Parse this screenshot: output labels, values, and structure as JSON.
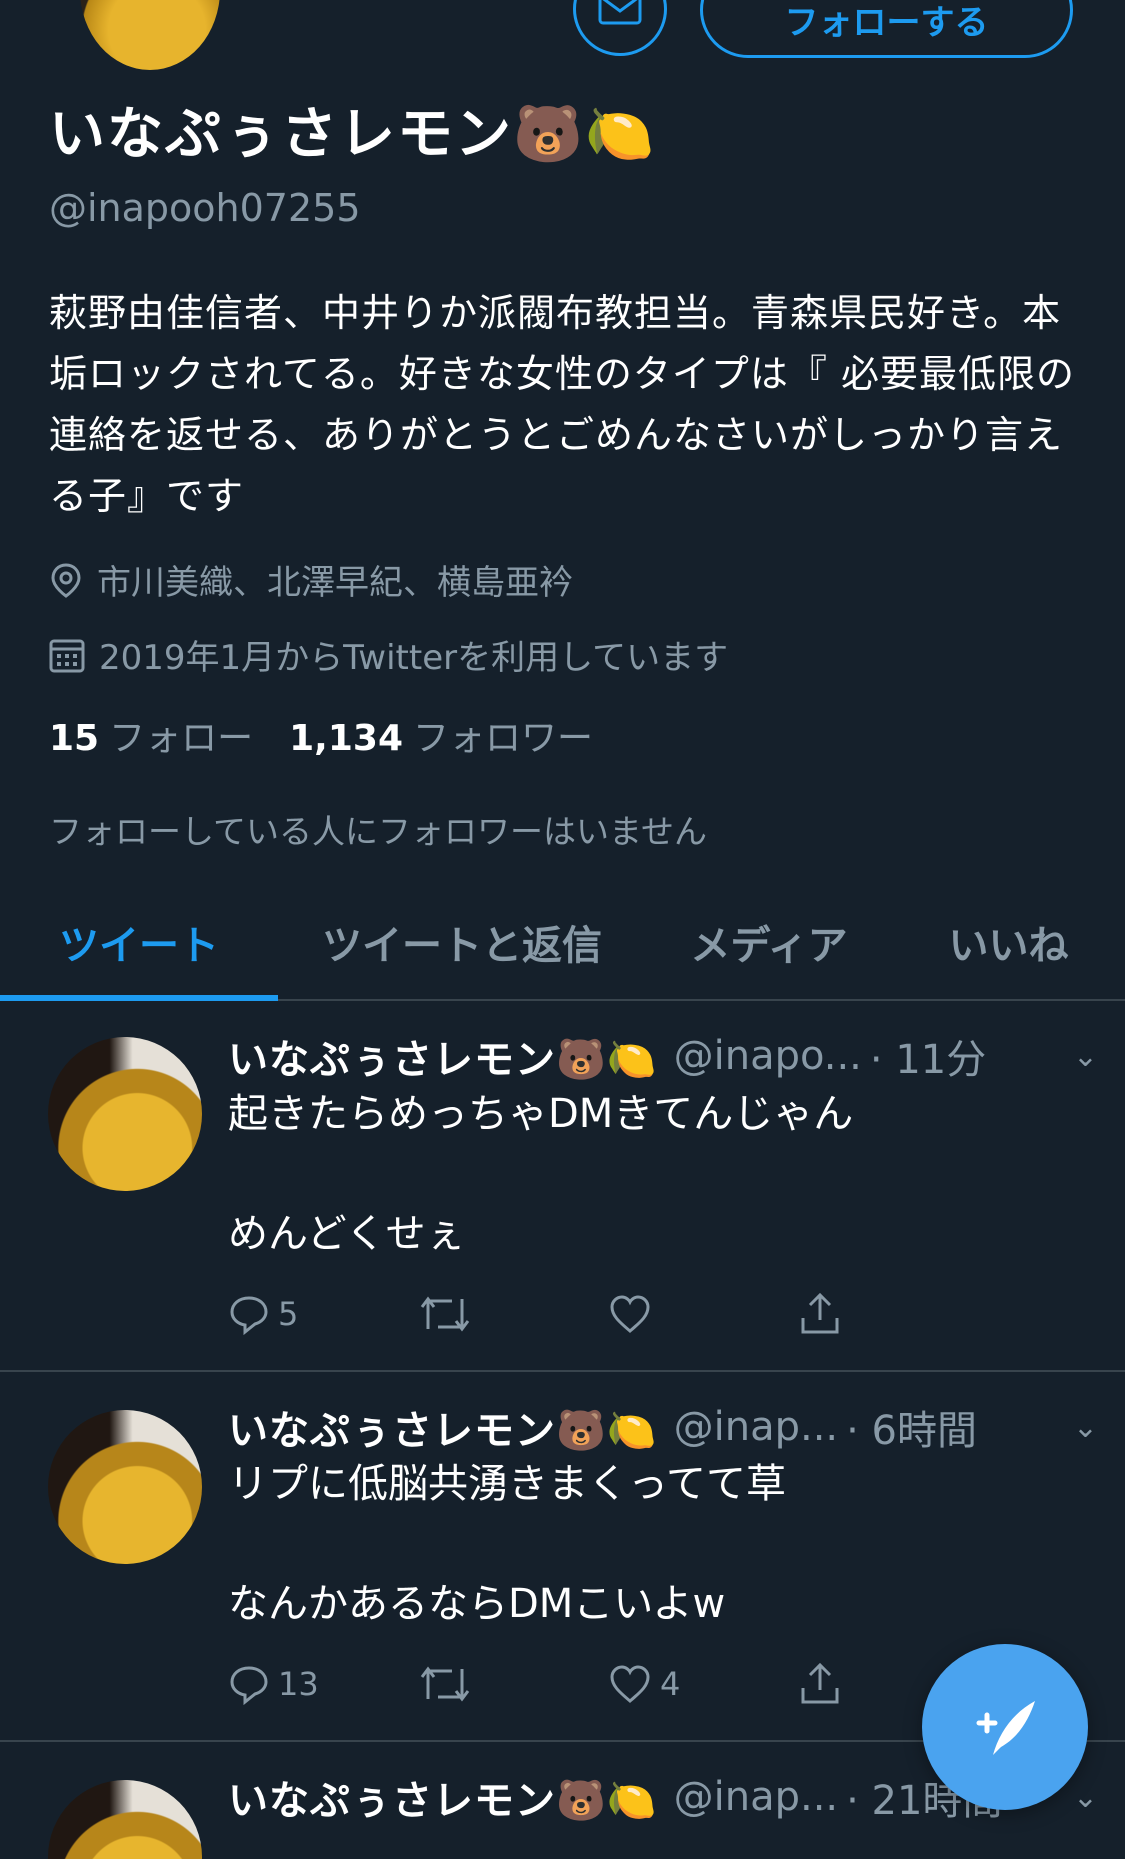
{
  "profile": {
    "display_name": "いなぷぅさレモン🐻🍋",
    "handle": "@inapooh07255",
    "follow_label": "フォローする",
    "bio": "萩野由佳信者、中井りか派閥布教担当。青森県民好き。本垢ロックされてる。好きな女性のタイプは『 必要最低限の連絡を返せる、ありがとうとごめんなさいがしっかり言える子』です",
    "location": "市川美織、北澤早紀、横島亜衿",
    "joined": "2019年1月からTwitterを利用しています",
    "following_count": "15",
    "following_label": "フォロー",
    "followers_count": "1,134",
    "followers_label": "フォロワー",
    "no_mutual_followers": "フォローしている人にフォロワーはいません"
  },
  "tabs": [
    {
      "label": "ツイート",
      "active": true
    },
    {
      "label": "ツイートと返信",
      "active": false
    },
    {
      "label": "メディア",
      "active": false
    },
    {
      "label": "いいね",
      "active": false
    }
  ],
  "tweets": [
    {
      "name": "いなぷぅさレモン🐻🍋",
      "handle": "@inapo...",
      "time": "· 11分",
      "text": "起きたらめっちゃDMきてんじゃん\n\nめんどくせぇ",
      "replies": "5",
      "retweets": "",
      "likes": ""
    },
    {
      "name": "いなぷぅさレモン🐻🍋",
      "handle": "@inap...",
      "time": "· 6時間",
      "text": "リプに低脳共湧きまくってて草\n\nなんかあるならDMこいよw",
      "replies": "13",
      "retweets": "",
      "likes": "4"
    },
    {
      "name": "いなぷぅさレモン🐻🍋",
      "handle": "@inap...",
      "time": "· 21時間",
      "text": "",
      "replies": "",
      "retweets": "",
      "likes": ""
    }
  ],
  "icons": {
    "message": "envelope-icon",
    "location": "location-pin-icon",
    "calendar": "calendar-icon",
    "reply": "reply-icon",
    "retweet": "retweet-icon",
    "like": "heart-icon",
    "share": "share-icon",
    "compose": "compose-tweet-icon",
    "more": "chevron-down-icon"
  },
  "colors": {
    "background": "#15202b",
    "accent": "#1d9bf0",
    "secondary_text": "#8899a6",
    "divider": "#38444d"
  }
}
